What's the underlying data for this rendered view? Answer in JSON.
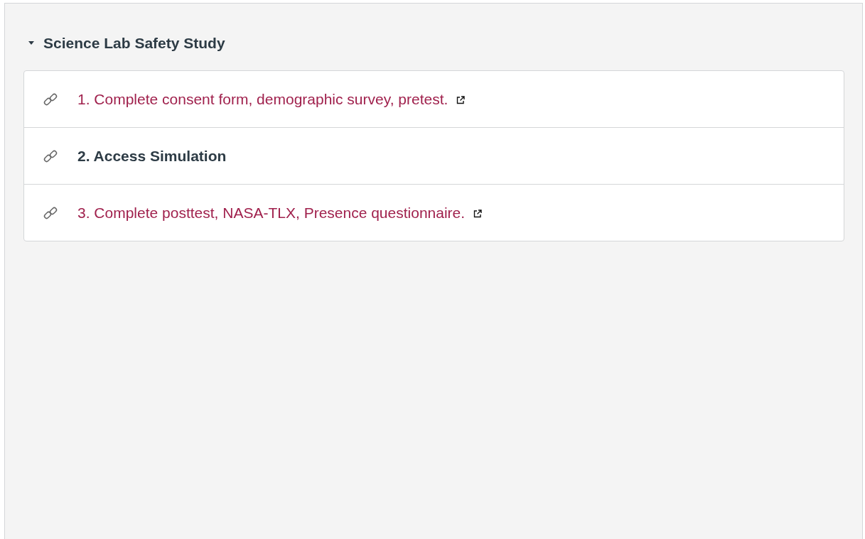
{
  "module": {
    "title": "Science Lab Safety Study",
    "expanded": true,
    "items": [
      {
        "kind": "external",
        "label": "1. Complete consent form, demographic survey, pretest."
      },
      {
        "kind": "plain",
        "label": "2. Access Simulation"
      },
      {
        "kind": "external",
        "label": "3. Complete posttest, NASA-TLX, Presence questionnaire."
      }
    ]
  }
}
